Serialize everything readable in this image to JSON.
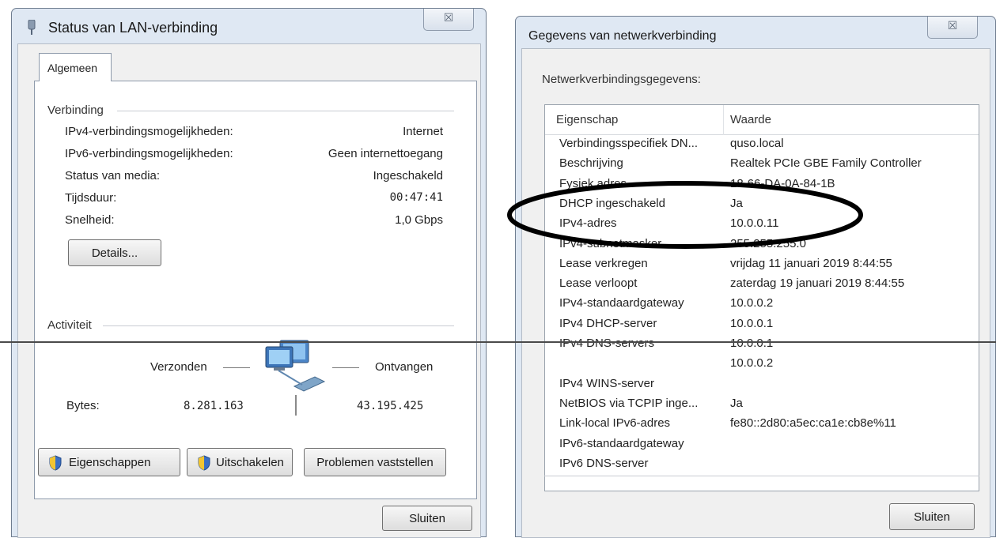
{
  "left_window": {
    "title": "Status van LAN-verbinding",
    "close_glyph": "☒",
    "tab_label": "Algemeen",
    "connection": {
      "group_label": "Verbinding",
      "rows": [
        {
          "label": "IPv4-verbindingsmogelijkheden:",
          "value": "Internet"
        },
        {
          "label": "IPv6-verbindingsmogelijkheden:",
          "value": "Geen internettoegang"
        },
        {
          "label": "Status van media:",
          "value": "Ingeschakeld"
        },
        {
          "label": "Tijdsduur:",
          "value": "00:47:41"
        },
        {
          "label": "Snelheid:",
          "value": "1,0 Gbps"
        }
      ],
      "details_button": "Details..."
    },
    "activity": {
      "group_label": "Activiteit",
      "sent_label": "Verzonden",
      "received_label": "Ontvangen",
      "bytes_label": "Bytes:",
      "bytes_sent": "8.281.163",
      "bytes_received": "43.195.425"
    },
    "buttons": {
      "properties": "Eigenschappen",
      "disable": "Uitschakelen",
      "diagnose": "Problemen vaststellen",
      "close": "Sluiten"
    },
    "icons": [
      "network-adapter-icon",
      "computers-network-icon",
      "shield-icon"
    ]
  },
  "right_window": {
    "title": "Gegevens van netwerkverbinding",
    "close_glyph": "☒",
    "section_label": "Netwerkverbindingsgegevens:",
    "columns": {
      "property": "Eigenschap",
      "value": "Waarde"
    },
    "rows": [
      {
        "property": "Verbindingsspecifiek DN...",
        "value": "quso.local"
      },
      {
        "property": "Beschrijving",
        "value": "Realtek PCIe GBE Family Controller"
      },
      {
        "property": "Fysiek adres",
        "value": "18-66-DA-0A-84-1B"
      },
      {
        "property": "DHCP ingeschakeld",
        "value": "Ja"
      },
      {
        "property": "IPv4-adres",
        "value": "10.0.0.11"
      },
      {
        "property": "IPv4-subnetmasker",
        "value": "255.255.255.0"
      },
      {
        "property": "Lease verkregen",
        "value": "vrijdag 11 januari 2019 8:44:55"
      },
      {
        "property": "Lease verloopt",
        "value": "zaterdag 19 januari 2019 8:44:55"
      },
      {
        "property": "IPv4-standaardgateway",
        "value": "10.0.0.2"
      },
      {
        "property": "IPv4 DHCP-server",
        "value": "10.0.0.1"
      },
      {
        "property": "IPv4 DNS-servers",
        "value": "10.0.0.1"
      },
      {
        "property": "",
        "value": "10.0.0.2"
      },
      {
        "property": "IPv4 WINS-server",
        "value": ""
      },
      {
        "property": "NetBIOS via TCPIP inge...",
        "value": "Ja"
      },
      {
        "property": "Link-local IPv6-adres",
        "value": "fe80::2d80:a5ec:ca1e:cb8e%11"
      },
      {
        "property": "IPv6-standaardgateway",
        "value": ""
      },
      {
        "property": "IPv6 DNS-server",
        "value": ""
      }
    ],
    "close_button": "Sluiten"
  },
  "colors": {
    "window_frame": "#dfe8f3",
    "client_bg": "#f0f0f0",
    "panel_bg": "#ffffff",
    "annotation": "#000000"
  }
}
